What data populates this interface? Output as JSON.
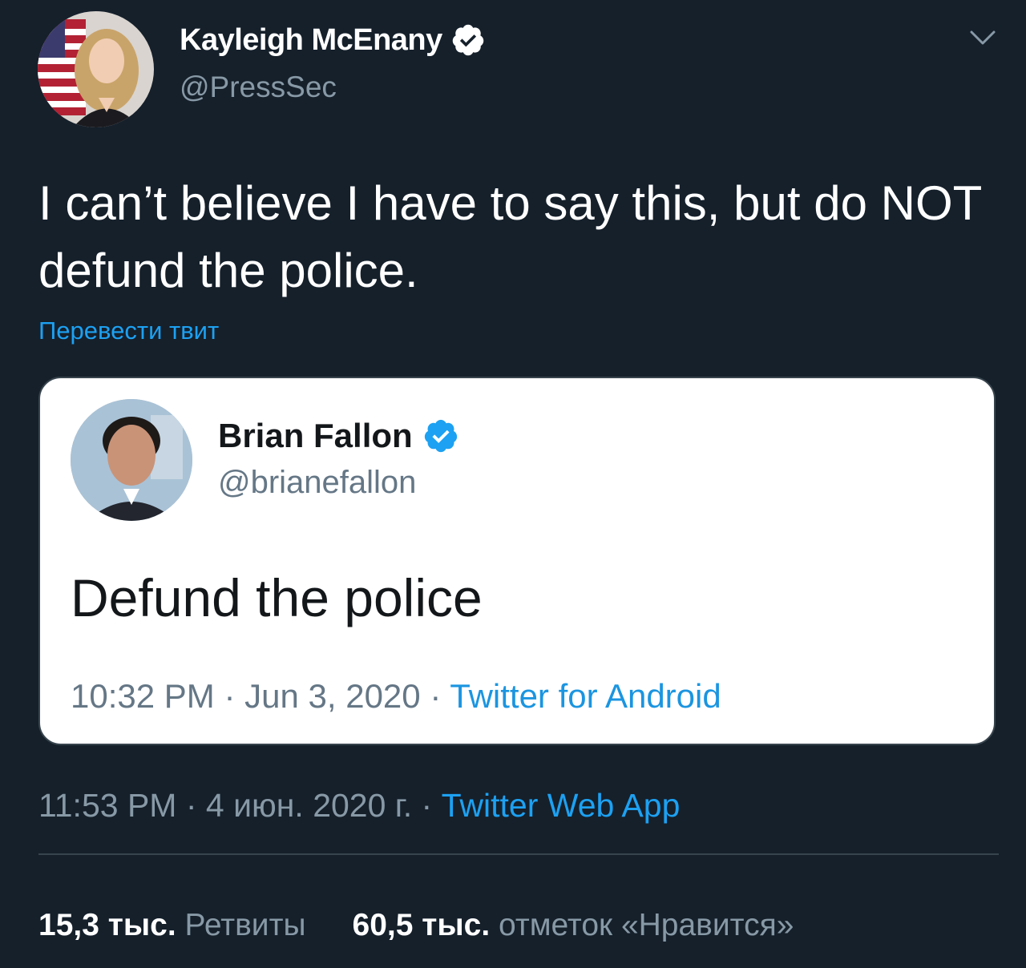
{
  "tweet": {
    "author": {
      "name": "Kayleigh McEnany",
      "handle": "@PressSec",
      "verified": true
    },
    "text": "I can’t believe I have to say this, but do NOT defund the police.",
    "translate_label": "Перевести твит",
    "quoted_tweet": {
      "author": {
        "name": "Brian Fallon",
        "handle": "@brianefallon",
        "verified": true
      },
      "text": "Defund the police",
      "time": "10:32 PM",
      "date": "Jun 3, 2020",
      "source": "Twitter for Android"
    },
    "time": "11:53 PM",
    "date": "4 июн. 2020 г.",
    "source": "Twitter Web App",
    "separator": "·",
    "stats": {
      "retweets_count": "15,3 тыс.",
      "retweets_label": "Ретвиты",
      "likes_count": "60,5 тыс.",
      "likes_label": "отметок «Нравится»"
    }
  },
  "colors": {
    "background": "#15202b",
    "accent": "#1da1f2",
    "secondary_text": "#8899a6",
    "card_background": "#ffffff"
  },
  "icons": {
    "more": "chevron-down-icon",
    "verified": "verified-badge-icon"
  }
}
